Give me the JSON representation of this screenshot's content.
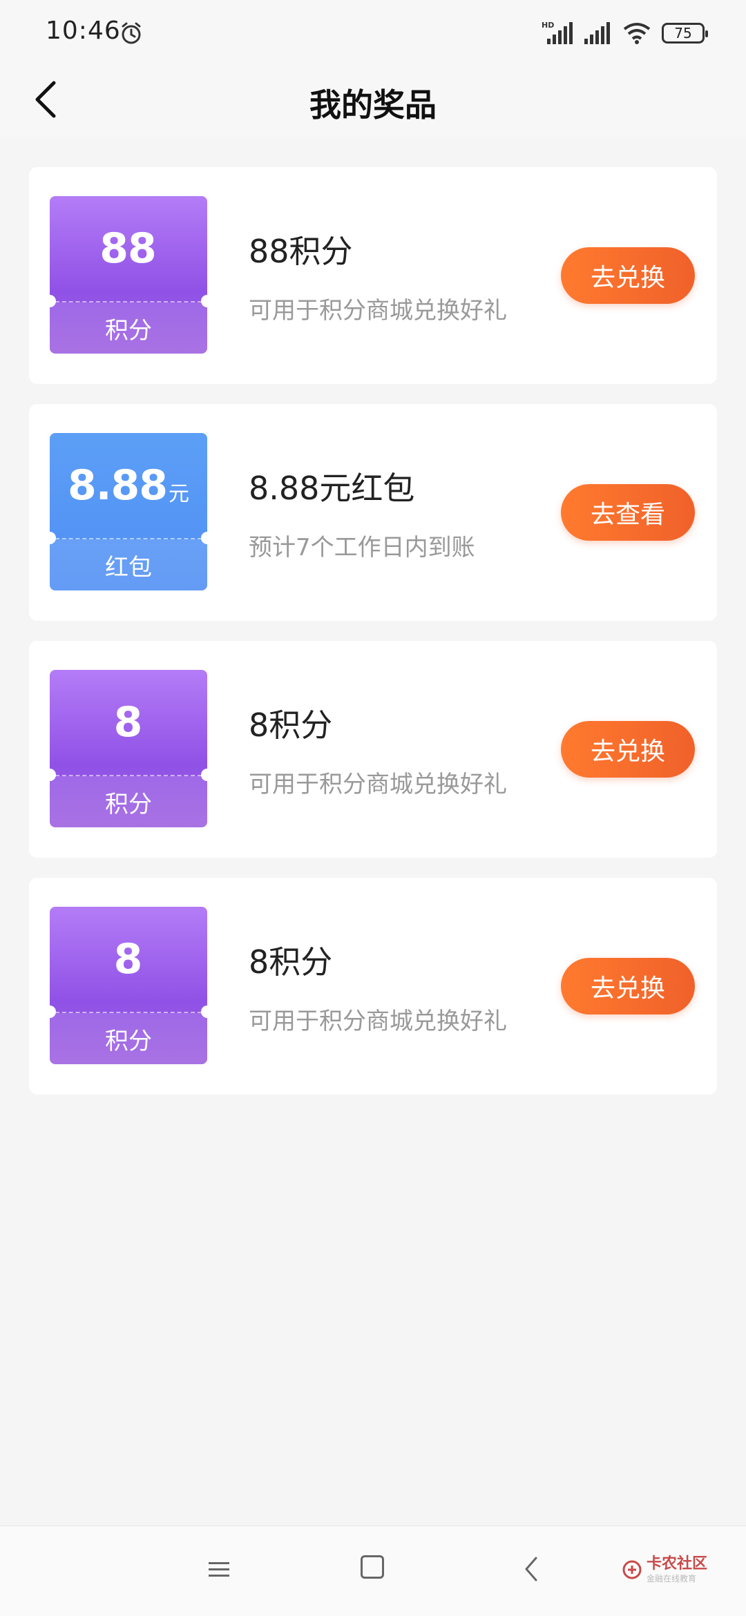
{
  "status_bar": {
    "time": "10:46",
    "network": "HD",
    "battery": "75",
    "icons": [
      "alarm-icon",
      "signal-icon",
      "wifi-icon",
      "battery-icon"
    ]
  },
  "header": {
    "title": "我的奖品",
    "back_icon": "chevron-left-icon"
  },
  "prizes": [
    {
      "coupon_value": "88",
      "coupon_unit": "",
      "coupon_label": "积分",
      "coupon_color": "#9b5ae8",
      "title": "88积分",
      "description": "可用于积分商城兑换好礼",
      "button": "去兑换"
    },
    {
      "coupon_value": "8.88",
      "coupon_unit": "元",
      "coupon_label": "红包",
      "coupon_color": "#4f8ef4",
      "title": "8.88元红包",
      "description": "预计7个工作日内到账",
      "button": "去查看"
    },
    {
      "coupon_value": "8",
      "coupon_unit": "",
      "coupon_label": "积分",
      "coupon_color": "#9b5ae8",
      "title": "8积分",
      "description": "可用于积分商城兑换好礼",
      "button": "去兑换"
    },
    {
      "coupon_value": "8",
      "coupon_unit": "",
      "coupon_label": "积分",
      "coupon_color": "#9b5ae8",
      "title": "8积分",
      "description": "可用于积分商城兑换好礼",
      "button": "去兑换"
    }
  ],
  "nav_bar": {
    "icons": [
      "menu-icon",
      "home-icon",
      "back-icon"
    ],
    "watermark": "卡农社区",
    "watermark_sub": "金融在线教育"
  },
  "colors": {
    "accent_orange": "#f26a2c",
    "purple": "#9b5ae8",
    "blue": "#4f8ef4",
    "background": "#f5f5f5"
  }
}
